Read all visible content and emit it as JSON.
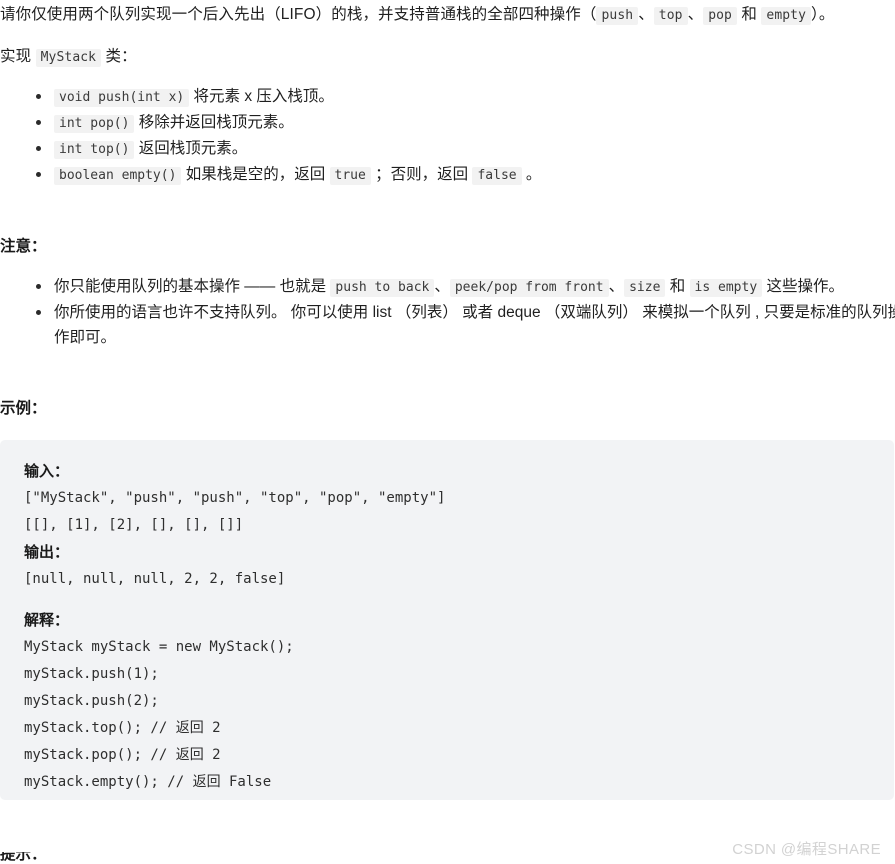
{
  "intro": {
    "part1": "请你仅使用两个队列实现一个后入先出（LIFO）的栈，并支持普通栈的全部四种操作（",
    "code1": "push",
    "sep1": "、",
    "code2": "top",
    "sep2": "、",
    "code3": "pop",
    "sep3": " 和 ",
    "code4": "empty",
    "part2": "）。"
  },
  "implement": {
    "prefix": "实现 ",
    "class_name": "MyStack",
    "suffix": " 类："
  },
  "methods": [
    {
      "code": "void push(int x)",
      "text": " 将元素 x 压入栈顶。"
    },
    {
      "code": "int pop()",
      "text": " 移除并返回栈顶元素。"
    },
    {
      "code": "int top()",
      "text": " 返回栈顶元素。"
    },
    {
      "code": "boolean empty()",
      "text_before": " 如果栈是空的，返回 ",
      "code_true": "true",
      "text_mid": " ；否则，返回 ",
      "code_false": "false",
      "text_after": " 。"
    }
  ],
  "notes": {
    "heading": "注意：",
    "item1": {
      "text_before": "你只能使用队列的基本操作 —— 也就是 ",
      "code1": "push to back",
      "sep1": "、",
      "code2": "peek/pop from front",
      "sep2": "、",
      "code3": "size",
      "sep3": " 和 ",
      "code4": "is empty",
      "text_after": " 这些操作。"
    },
    "item2": "你所使用的语言也许不支持队列。 你可以使用 list （列表） 或者 deque （双端队列） 来模拟一个队列 , 只要是标准的队列操作即可。"
  },
  "example": {
    "heading": "示例：",
    "input_label": "输入：",
    "input_lines": [
      "[\"MyStack\", \"push\", \"push\", \"top\", \"pop\", \"empty\"]",
      "[[], [1], [2], [], [], []]"
    ],
    "output_label": "输出：",
    "output_lines": [
      "[null, null, null, 2, 2, false]"
    ],
    "explain_label": "解释：",
    "explain_lines": [
      "MyStack myStack = new MyStack();",
      "myStack.push(1);",
      "myStack.push(2);",
      "myStack.top(); // 返回 2",
      "myStack.pop(); // 返回 2",
      "myStack.empty(); // 返回 False"
    ]
  },
  "bottom_heading": "提示：",
  "watermark": "CSDN @编程SHARE",
  "colors": {
    "page_background": "#ffffff",
    "code_block_background": "#f2f3f5",
    "inline_code_background": "#f2f2f2",
    "text": "#1f1f1f",
    "watermark": "#d2d2d2"
  }
}
